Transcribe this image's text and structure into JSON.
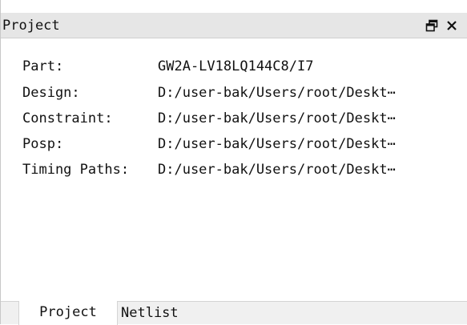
{
  "panel": {
    "title": "Project",
    "float_icon": "float-window-icon",
    "close_icon": "close-icon"
  },
  "properties": [
    {
      "label": "Part:",
      "value": "GW2A-LV18LQ144C8/I7"
    },
    {
      "label": "Design:",
      "value": "D:/user-bak/Users/root/Deskt⋯"
    },
    {
      "label": "Constraint:",
      "value": "D:/user-bak/Users/root/Deskt⋯"
    },
    {
      "label": "Posp:",
      "value": "D:/user-bak/Users/root/Deskt⋯"
    },
    {
      "label": "Timing Paths:",
      "value": "D:/user-bak/Users/root/Deskt⋯"
    }
  ],
  "tabs": [
    {
      "label": "Project",
      "active": true
    },
    {
      "label": "Netlist",
      "active": false
    }
  ]
}
